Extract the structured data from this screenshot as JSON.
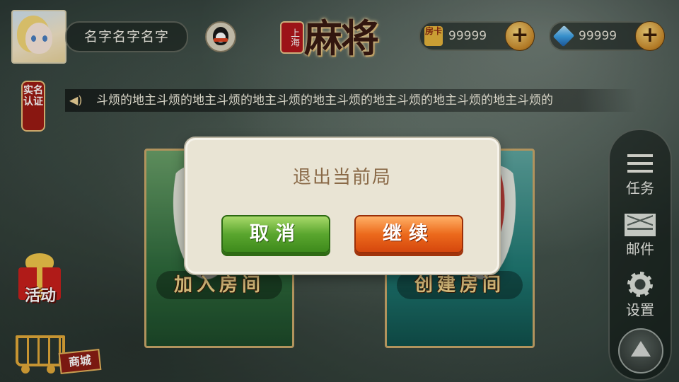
{
  "player": {
    "name": "名字名字名字",
    "avatar_icon": "avatar-anime-girl"
  },
  "logo": {
    "seal": "上海",
    "title": "麻将"
  },
  "currency": {
    "room_card_label": "房卡",
    "room_cards": "99999",
    "diamonds": "99999",
    "plus": "+"
  },
  "notice": {
    "verify_badge": "实名认证",
    "text": "斗烦的地主斗烦的地主斗烦的地主斗烦的地主斗烦的地主斗烦的地主斗烦的地主斗烦的"
  },
  "rooms": {
    "join_label": "加入房间",
    "create_label": "创建房间"
  },
  "side_menu": {
    "tasks": "任务",
    "mail": "邮件",
    "settings": "设置"
  },
  "left_menu": {
    "activity": "活动",
    "shop": "商城"
  },
  "dialog": {
    "title": "退出当前局",
    "cancel_label": "取消",
    "continue_label": "继续"
  },
  "colors": {
    "cancel_green": "#5aa62e",
    "continue_orange": "#ec6a1c",
    "dialog_bg": "#e9e4d4",
    "title_brown": "#8a6a48",
    "gold": "#e2a93a"
  }
}
